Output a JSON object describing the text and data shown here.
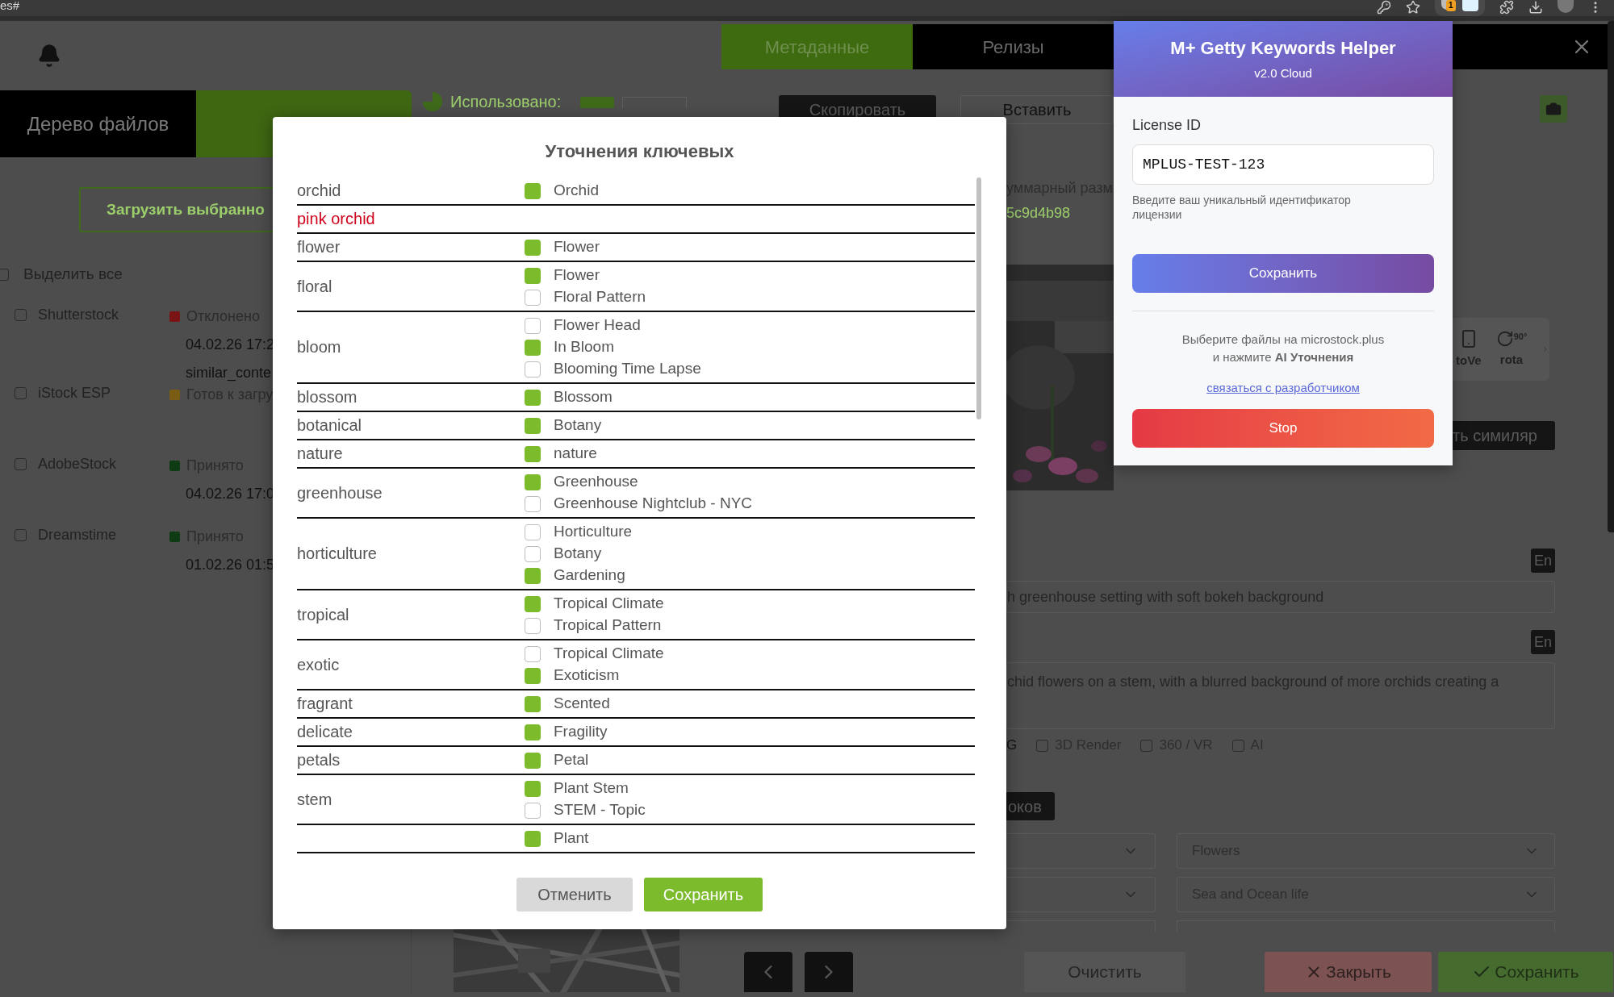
{
  "browser": {
    "address_fragment": "es#",
    "extension_badge": "1"
  },
  "header": {
    "tabs": [
      {
        "label": "Метаданные",
        "selected": true
      },
      {
        "label": "Релизы",
        "selected": false
      }
    ]
  },
  "left_panel": {
    "tabs": [
      {
        "label": "Дерево файлов",
        "selected": false
      },
      {
        "selected": true
      }
    ],
    "used_label": "Использовано:",
    "upload_button": "Загрузить выбранно",
    "select_all": {
      "label": "Выделить все",
      "checked": false
    },
    "agencies": [
      {
        "name": "Shutterstock",
        "checked": false,
        "status": "Отклонено",
        "color": "#7a1414",
        "lines": [
          "04.02.26 17:2",
          "similar_conte"
        ]
      },
      {
        "name": "iStock ESP",
        "checked": false,
        "status": "Готов к загру",
        "color": "#7a5c12"
      },
      {
        "name": "AdobeStock",
        "checked": false,
        "status": "Принято",
        "color": "#0f3b14",
        "lines": [
          "04.02.26 17:0"
        ]
      },
      {
        "name": "Dreamstime",
        "checked": false,
        "status": "Принято",
        "color": "#0f3b14",
        "lines": [
          "01.02.26 01:5"
        ]
      }
    ]
  },
  "right_panel": {
    "copy_button": "Скопировать",
    "paste_button": "Вставить",
    "size_label": "уммарный разм",
    "hash": "5c9d4b98",
    "tools": [
      {
        "label": "toVe",
        "kind": "phone"
      },
      {
        "label": "rota",
        "kind": "rotate",
        "badge": "90°"
      }
    ],
    "similar_button": "ть симиляр",
    "title_lang": "En",
    "title": "h greenhouse setting with soft bokeh background",
    "description_lang": "En",
    "description": "chid flowers on a stem, with a blurred background of more orchids creating a",
    "flag_fragment": "G",
    "flags": [
      {
        "label": "3D Render",
        "checked": false
      },
      {
        "label": "360 / VR",
        "checked": false
      },
      {
        "label": "AI",
        "checked": false
      }
    ],
    "keywords_button": "оков",
    "categories": [
      {
        "value": "Flowers"
      },
      {
        "value": "Sea and Ocean life"
      }
    ],
    "clear_button": "Очистить",
    "close_button": "Закрыть",
    "save_button": "Сохранить"
  },
  "modal": {
    "title": "Уточнения ключевых",
    "rows": [
      {
        "keyword": "orchid",
        "color": "#555555",
        "options": [
          {
            "label": "Orchid",
            "checked": true
          }
        ]
      },
      {
        "keyword": "pink orchid",
        "color": "#d0021b"
      },
      {
        "keyword": "flower",
        "color": "#555555",
        "options": [
          {
            "label": "Flower",
            "checked": true
          }
        ]
      },
      {
        "keyword": "floral",
        "color": "#555555",
        "options": [
          {
            "label": "Flower",
            "checked": true
          },
          {
            "label": "Floral Pattern",
            "checked": false
          }
        ]
      },
      {
        "keyword": "bloom",
        "color": "#555555",
        "options": [
          {
            "label": "Flower Head",
            "checked": false
          },
          {
            "label": "In Bloom",
            "checked": true
          },
          {
            "label": "Blooming Time Lapse",
            "checked": false
          }
        ]
      },
      {
        "keyword": "blossom",
        "color": "#555555",
        "options": [
          {
            "label": "Blossom",
            "checked": true
          }
        ]
      },
      {
        "keyword": "botanical",
        "color": "#555555",
        "options": [
          {
            "label": "Botany",
            "checked": true
          }
        ]
      },
      {
        "keyword": "nature",
        "color": "#555555",
        "options": [
          {
            "label": "nature",
            "checked": true
          }
        ]
      },
      {
        "keyword": "greenhouse",
        "color": "#555555",
        "options": [
          {
            "label": "Greenhouse",
            "checked": true
          },
          {
            "label": "Greenhouse Nightclub - NYC",
            "checked": false
          }
        ]
      },
      {
        "keyword": "horticulture",
        "color": "#555555",
        "options": [
          {
            "label": "Horticulture",
            "checked": false
          },
          {
            "label": "Botany",
            "checked": false
          },
          {
            "label": "Gardening",
            "checked": true
          }
        ]
      },
      {
        "keyword": "tropical",
        "color": "#555555",
        "options": [
          {
            "label": "Tropical Climate",
            "checked": true
          },
          {
            "label": "Tropical Pattern",
            "checked": false
          }
        ]
      },
      {
        "keyword": "exotic",
        "color": "#555555",
        "options": [
          {
            "label": "Tropical Climate",
            "checked": false
          },
          {
            "label": "Exoticism",
            "checked": true
          }
        ]
      },
      {
        "keyword": "fragrant",
        "color": "#555555",
        "options": [
          {
            "label": "Scented",
            "checked": true
          }
        ]
      },
      {
        "keyword": "delicate",
        "color": "#555555",
        "options": [
          {
            "label": "Fragility",
            "checked": true
          }
        ]
      },
      {
        "keyword": "petals",
        "color": "#555555",
        "options": [
          {
            "label": "Petal",
            "checked": true
          }
        ]
      },
      {
        "keyword": "stem",
        "color": "#555555",
        "options": [
          {
            "label": "Plant Stem",
            "checked": true
          },
          {
            "label": "STEM - Topic",
            "checked": false
          }
        ]
      },
      {
        "options": [
          {
            "label": "Plant",
            "checked": true
          }
        ]
      }
    ],
    "cancel_button": "Отменить",
    "save_button": "Сохранить"
  },
  "popup": {
    "title": "M+ Getty Keywords Helper",
    "version": "v2.0 Cloud",
    "license_label": "License ID",
    "license_value": "MPLUS-TEST-123",
    "hint": "Введите ваш уникальный идентификатор лицензии",
    "save_button": "Сохранить",
    "info": "Выберите файлы на microstock.plus\nи нажмите **AI Уточнения**",
    "link": "связаться с разработчиком",
    "stop_button": "Stop"
  }
}
